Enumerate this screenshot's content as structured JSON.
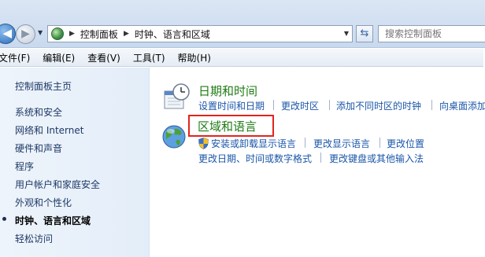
{
  "breadcrumb": [
    "控制面板",
    "时钟、语言和区域"
  ],
  "search": {
    "placeholder": "搜索控制面板"
  },
  "menu": [
    "文件(F)",
    "编辑(E)",
    "查看(V)",
    "工具(T)",
    "帮助(H)"
  ],
  "sidebar": {
    "home": "控制面板主页",
    "items": [
      "系统和安全",
      "网络和 Internet",
      "硬件和声音",
      "程序",
      "用户帐户和家庭安全",
      "外观和个性化",
      "时钟、语言和区域",
      "轻松访问"
    ],
    "active_index": 6
  },
  "categories": [
    {
      "title": "日期和时间",
      "links": [
        "设置时间和日期",
        "更改时区",
        "添加不同时区的时钟",
        "向桌面添加"
      ]
    },
    {
      "title": "区域和语言",
      "links": [
        "安装或卸载显示语言",
        "更改显示语言",
        "更改位置"
      ],
      "links2": [
        "更改日期、时间或数字格式",
        "更改键盘或其他输入法"
      ]
    }
  ],
  "colors": {
    "link": "#1a56a8",
    "category_title": "#1e7b14",
    "highlight": "#e2241d",
    "sidebar_bg": "#e9f1fa"
  }
}
